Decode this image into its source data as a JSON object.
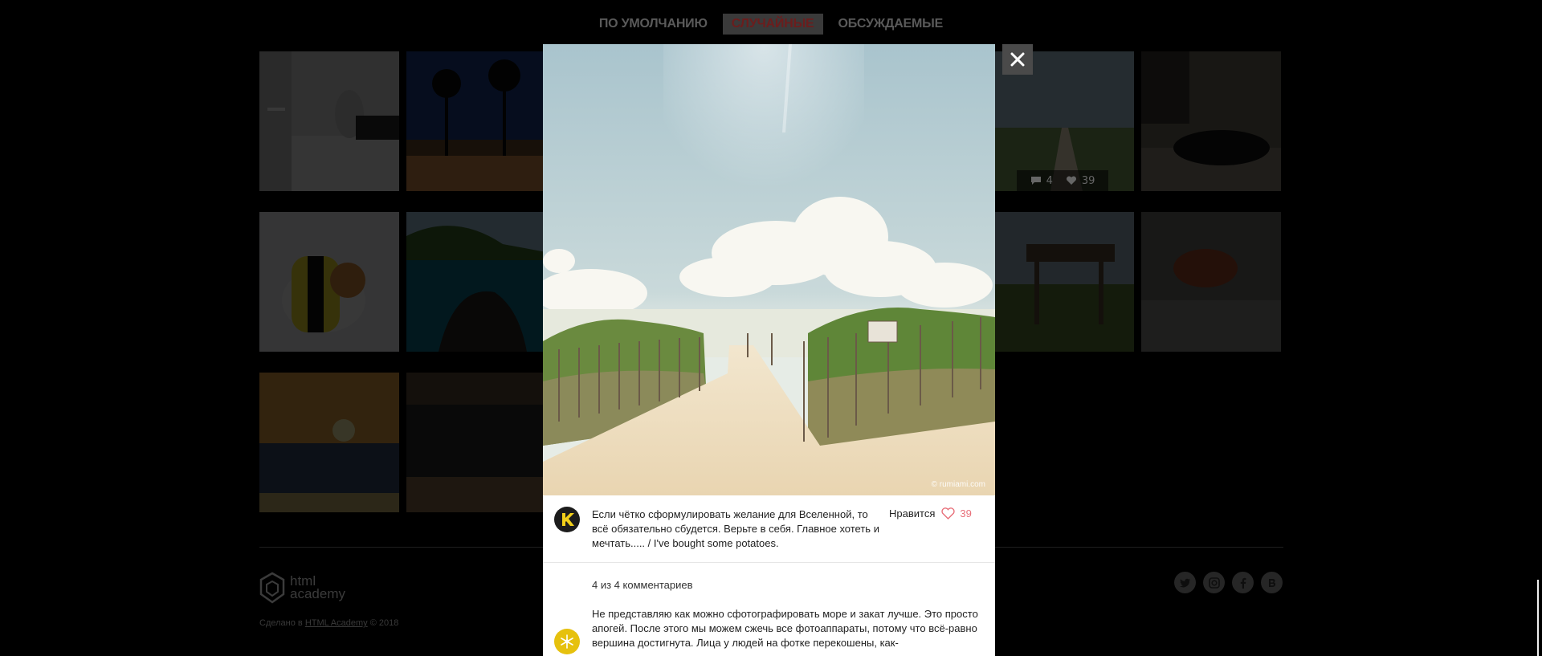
{
  "filters": [
    {
      "label": "По умолчанию",
      "active": false
    },
    {
      "label": "Случайные",
      "active": true
    },
    {
      "label": "Обсуждаемые",
      "active": false
    }
  ],
  "gallery": {
    "tile_stats": {
      "comments": "4",
      "likes": "39"
    }
  },
  "modal": {
    "photo_credit": "© rumiami.com",
    "close_label": "✕",
    "post": {
      "avatar_letter": "K",
      "description": "Если чётко сформулировать желание для Вселенной, то всё обязательно сбудется. Верьте в себя. Главное хотеть и мечтать..... / I've bought some potatoes.",
      "likes_label": "Нравится",
      "likes_count": "39"
    },
    "comments": {
      "count_label": "4 из 4 комментариев",
      "first": {
        "avatar_icon": "snowflake-icon",
        "text": "Не представляю как можно сфотографировать море и закат лучше. Это просто апогей. После этого мы можем сжечь все фотоаппараты, потому что всё-равно вершина достигнута. Лица у людей на фотке перекошены, как-"
      }
    }
  },
  "footer": {
    "logo_line1": "html",
    "logo_line2": "academy",
    "made_prefix": "Сделано в ",
    "made_link": "HTML Academy",
    "made_suffix": " © 2018",
    "socials": [
      "twitter-icon",
      "instagram-icon",
      "facebook-icon",
      "vk-icon"
    ]
  },
  "colors": {
    "accent_like": "#e8707a",
    "avatar_comment": "#e6c10e",
    "active_filter_text": "#6b1d1d"
  }
}
